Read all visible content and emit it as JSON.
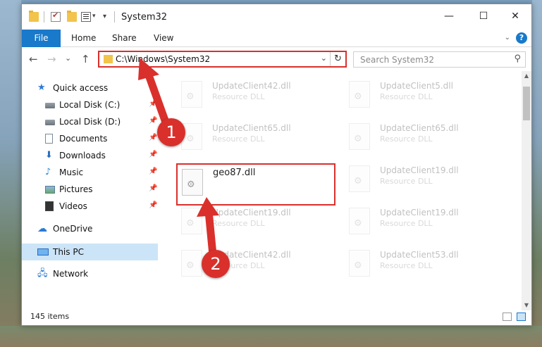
{
  "window": {
    "title": "System32",
    "controls": {
      "minimize": "—",
      "maximize": "☐",
      "close": "✕"
    }
  },
  "ribbon": {
    "tabs": [
      "File",
      "Home",
      "Share",
      "View"
    ],
    "help": "?"
  },
  "nav": {
    "back": "←",
    "forward": "→",
    "recent": "⌄",
    "up": "↑",
    "address": "C:\\Windows\\System32",
    "address_dropdown": "⌄",
    "refresh": "↻",
    "search_placeholder": "Search System32",
    "search_icon": "⚲"
  },
  "sidebar": {
    "items": [
      {
        "label": "Quick access",
        "icon": "star-icon",
        "pinned": false
      },
      {
        "label": "Local Disk (C:)",
        "icon": "disk-icon",
        "pinned": true
      },
      {
        "label": "Local Disk (D:)",
        "icon": "disk-icon",
        "pinned": true
      },
      {
        "label": "Documents",
        "icon": "documents-icon",
        "pinned": true
      },
      {
        "label": "Downloads",
        "icon": "downloads-icon",
        "pinned": true
      },
      {
        "label": "Music",
        "icon": "music-icon",
        "pinned": true
      },
      {
        "label": "Pictures",
        "icon": "pictures-icon",
        "pinned": true
      },
      {
        "label": "Videos",
        "icon": "videos-icon",
        "pinned": true
      },
      {
        "label": "OneDrive",
        "icon": "onedrive-icon",
        "pinned": false
      },
      {
        "label": "This PC",
        "icon": "this-pc-icon",
        "pinned": false,
        "selected": true
      },
      {
        "label": "Network",
        "icon": "network-icon",
        "pinned": false
      }
    ],
    "pin_glyph": "📌"
  },
  "files": [
    {
      "name": "UpdateClient42.dll",
      "type": "Resource DLL",
      "faded": true
    },
    {
      "name": "UpdateClient5.dll",
      "type": "Resource DLL",
      "faded": true
    },
    {
      "name": "UpdateClient65.dll",
      "type": "Resource DLL",
      "faded": true
    },
    {
      "name": "UpdateClient65.dll",
      "type": "Resource DLL",
      "faded": true
    },
    {
      "name": "geo87.dll",
      "type": "",
      "faded": false,
      "highlighted": true
    },
    {
      "name": "UpdateClient19.dll",
      "type": "Resource DLL",
      "faded": true
    },
    {
      "name": "UpdateClient19.dll",
      "type": "Resource DLL",
      "faded": true
    },
    {
      "name": "UpdateClient19.dll",
      "type": "Resource DLL",
      "faded": true
    },
    {
      "name": "UpdateClient42.dll",
      "type": "Resource DLL",
      "faded": true
    },
    {
      "name": "UpdateClient53.dll",
      "type": "Resource DLL",
      "faded": true
    }
  ],
  "status": {
    "item_count": "145 items"
  },
  "annotations": [
    {
      "number": "1",
      "color": "#d9302c"
    },
    {
      "number": "2",
      "color": "#d9302c"
    }
  ],
  "colors": {
    "accent": "#1979ca",
    "highlight_border": "#d9302c",
    "selected_bg": "#cce4f7"
  }
}
